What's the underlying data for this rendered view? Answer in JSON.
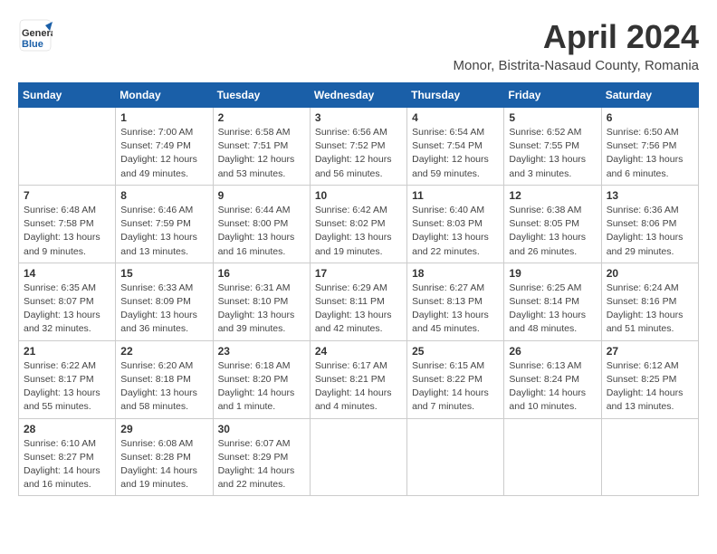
{
  "header": {
    "logo_line1": "General",
    "logo_line2": "Blue",
    "month_title": "April 2024",
    "subtitle": "Monor, Bistrita-Nasaud County, Romania"
  },
  "columns": [
    "Sunday",
    "Monday",
    "Tuesday",
    "Wednesday",
    "Thursday",
    "Friday",
    "Saturday"
  ],
  "weeks": [
    [
      {
        "day": "",
        "info": ""
      },
      {
        "day": "1",
        "info": "Sunrise: 7:00 AM\nSunset: 7:49 PM\nDaylight: 12 hours\nand 49 minutes."
      },
      {
        "day": "2",
        "info": "Sunrise: 6:58 AM\nSunset: 7:51 PM\nDaylight: 12 hours\nand 53 minutes."
      },
      {
        "day": "3",
        "info": "Sunrise: 6:56 AM\nSunset: 7:52 PM\nDaylight: 12 hours\nand 56 minutes."
      },
      {
        "day": "4",
        "info": "Sunrise: 6:54 AM\nSunset: 7:54 PM\nDaylight: 12 hours\nand 59 minutes."
      },
      {
        "day": "5",
        "info": "Sunrise: 6:52 AM\nSunset: 7:55 PM\nDaylight: 13 hours\nand 3 minutes."
      },
      {
        "day": "6",
        "info": "Sunrise: 6:50 AM\nSunset: 7:56 PM\nDaylight: 13 hours\nand 6 minutes."
      }
    ],
    [
      {
        "day": "7",
        "info": "Sunrise: 6:48 AM\nSunset: 7:58 PM\nDaylight: 13 hours\nand 9 minutes."
      },
      {
        "day": "8",
        "info": "Sunrise: 6:46 AM\nSunset: 7:59 PM\nDaylight: 13 hours\nand 13 minutes."
      },
      {
        "day": "9",
        "info": "Sunrise: 6:44 AM\nSunset: 8:00 PM\nDaylight: 13 hours\nand 16 minutes."
      },
      {
        "day": "10",
        "info": "Sunrise: 6:42 AM\nSunset: 8:02 PM\nDaylight: 13 hours\nand 19 minutes."
      },
      {
        "day": "11",
        "info": "Sunrise: 6:40 AM\nSunset: 8:03 PM\nDaylight: 13 hours\nand 22 minutes."
      },
      {
        "day": "12",
        "info": "Sunrise: 6:38 AM\nSunset: 8:05 PM\nDaylight: 13 hours\nand 26 minutes."
      },
      {
        "day": "13",
        "info": "Sunrise: 6:36 AM\nSunset: 8:06 PM\nDaylight: 13 hours\nand 29 minutes."
      }
    ],
    [
      {
        "day": "14",
        "info": "Sunrise: 6:35 AM\nSunset: 8:07 PM\nDaylight: 13 hours\nand 32 minutes."
      },
      {
        "day": "15",
        "info": "Sunrise: 6:33 AM\nSunset: 8:09 PM\nDaylight: 13 hours\nand 36 minutes."
      },
      {
        "day": "16",
        "info": "Sunrise: 6:31 AM\nSunset: 8:10 PM\nDaylight: 13 hours\nand 39 minutes."
      },
      {
        "day": "17",
        "info": "Sunrise: 6:29 AM\nSunset: 8:11 PM\nDaylight: 13 hours\nand 42 minutes."
      },
      {
        "day": "18",
        "info": "Sunrise: 6:27 AM\nSunset: 8:13 PM\nDaylight: 13 hours\nand 45 minutes."
      },
      {
        "day": "19",
        "info": "Sunrise: 6:25 AM\nSunset: 8:14 PM\nDaylight: 13 hours\nand 48 minutes."
      },
      {
        "day": "20",
        "info": "Sunrise: 6:24 AM\nSunset: 8:16 PM\nDaylight: 13 hours\nand 51 minutes."
      }
    ],
    [
      {
        "day": "21",
        "info": "Sunrise: 6:22 AM\nSunset: 8:17 PM\nDaylight: 13 hours\nand 55 minutes."
      },
      {
        "day": "22",
        "info": "Sunrise: 6:20 AM\nSunset: 8:18 PM\nDaylight: 13 hours\nand 58 minutes."
      },
      {
        "day": "23",
        "info": "Sunrise: 6:18 AM\nSunset: 8:20 PM\nDaylight: 14 hours\nand 1 minute."
      },
      {
        "day": "24",
        "info": "Sunrise: 6:17 AM\nSunset: 8:21 PM\nDaylight: 14 hours\nand 4 minutes."
      },
      {
        "day": "25",
        "info": "Sunrise: 6:15 AM\nSunset: 8:22 PM\nDaylight: 14 hours\nand 7 minutes."
      },
      {
        "day": "26",
        "info": "Sunrise: 6:13 AM\nSunset: 8:24 PM\nDaylight: 14 hours\nand 10 minutes."
      },
      {
        "day": "27",
        "info": "Sunrise: 6:12 AM\nSunset: 8:25 PM\nDaylight: 14 hours\nand 13 minutes."
      }
    ],
    [
      {
        "day": "28",
        "info": "Sunrise: 6:10 AM\nSunset: 8:27 PM\nDaylight: 14 hours\nand 16 minutes."
      },
      {
        "day": "29",
        "info": "Sunrise: 6:08 AM\nSunset: 8:28 PM\nDaylight: 14 hours\nand 19 minutes."
      },
      {
        "day": "30",
        "info": "Sunrise: 6:07 AM\nSunset: 8:29 PM\nDaylight: 14 hours\nand 22 minutes."
      },
      {
        "day": "",
        "info": ""
      },
      {
        "day": "",
        "info": ""
      },
      {
        "day": "",
        "info": ""
      },
      {
        "day": "",
        "info": ""
      }
    ]
  ]
}
